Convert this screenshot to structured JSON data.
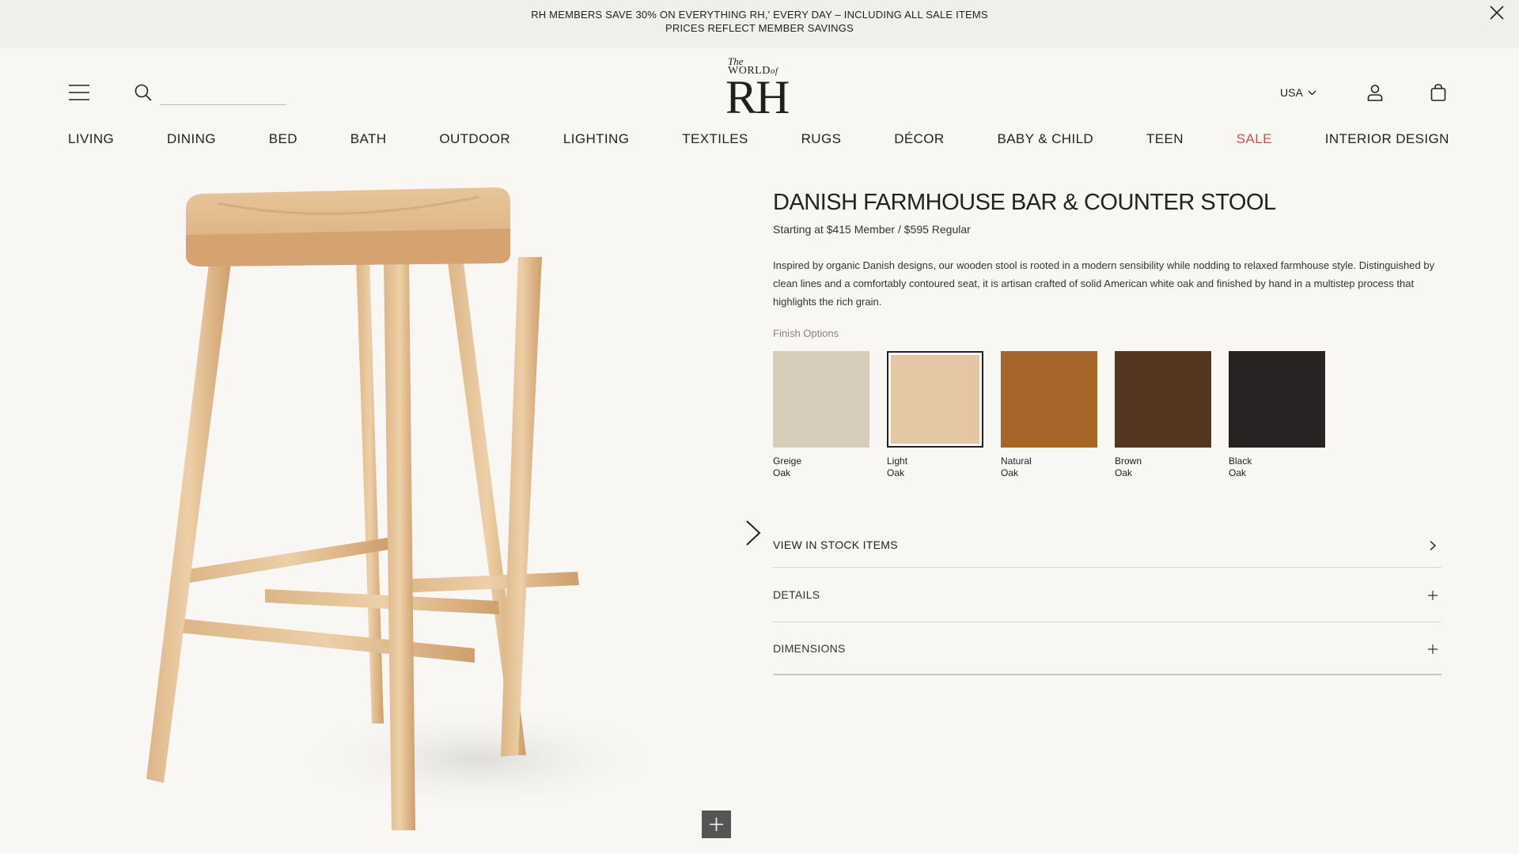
{
  "promo": {
    "line1": "RH MEMBERS SAVE 30% ON EVERYTHING RH,' EVERY DAY – INCLUDING ALL SALE ITEMS",
    "line2": "PRICES REFLECT MEMBER SAVINGS",
    "close_icon": "close-icon"
  },
  "header": {
    "menu_icon": "hamburger-menu-icon",
    "search_icon": "search-icon",
    "search_value": "",
    "logo": {
      "the": "The",
      "world": "WORLD",
      "of": "of",
      "rh": "RH"
    },
    "country": "USA",
    "account_icon": "user-account-icon",
    "cart_icon": "shopping-bag-icon"
  },
  "nav": {
    "items": [
      "LIVING",
      "DINING",
      "BED",
      "BATH",
      "OUTDOOR",
      "LIGHTING",
      "TEXTILES",
      "RUGS",
      "DÉCOR",
      "BABY & CHILD",
      "TEEN",
      "SALE",
      "INTERIOR DESIGN"
    ],
    "sale_color": "#c0544f"
  },
  "product": {
    "title": "DANISH FARMHOUSE BAR & COUNTER STOOL",
    "price": "Starting at $415 Member / $595 Regular",
    "description": "Inspired by organic Danish designs, our wooden stool is rooted in a modern sensibility while nodding to relaxed farmhouse style. Distinguished by clean lines and a comfortably contoured seat, it is artisan crafted of solid American white oak and finished by hand in a multistep process that highlights the rich grain.",
    "finish_label": "Finish Options",
    "finishes": [
      {
        "line1": "Greige",
        "line2": "Oak",
        "color": "#d8ccbb",
        "selected": false
      },
      {
        "line1": "Light",
        "line2": "Oak",
        "color": "#e4c7a2",
        "selected": true
      },
      {
        "line1": "Natural",
        "line2": "Oak",
        "color": "#a7652a",
        "selected": false
      },
      {
        "line1": "Brown",
        "line2": "Oak",
        "color": "#553620",
        "selected": false
      },
      {
        "line1": "Black",
        "line2": "Oak",
        "color": "#262322",
        "selected": false
      }
    ],
    "accordions": {
      "in_stock": "VIEW IN STOCK ITEMS",
      "details": "DETAILS",
      "dimensions": "DIMENSIONS"
    }
  },
  "gallery": {
    "next_icon": "chevron-right-icon",
    "zoom_icon": "plus-icon"
  }
}
